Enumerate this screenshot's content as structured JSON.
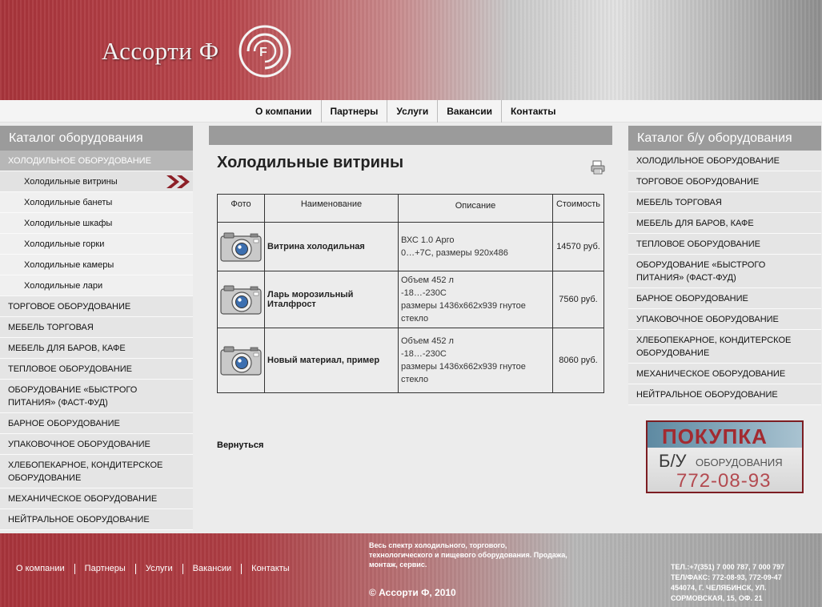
{
  "header": {
    "logo_text": "Ассорти Ф",
    "colors": {
      "brand_red": "#a8343b",
      "silver": "#c9c9c9"
    }
  },
  "top_nav": [
    "О компании",
    "Партнеры",
    "Услуги",
    "Вакансии",
    "Контакты"
  ],
  "left_sidebar": {
    "title": "Каталог оборудования",
    "active_category": "ХОЛОДИЛЬНОЕ ОБОРУДОВАНИЕ",
    "subitems": [
      "Холодильные витрины",
      "Холодильные банеты",
      "Холодильные шкафы",
      "Холодильные горки",
      "Холодильные камеры",
      "Холодильные лари"
    ],
    "current_subitem": "Холодильные витрины",
    "categories": [
      "ТОРГОВОЕ ОБОРУДОВАНИЕ",
      "МЕБЕЛЬ ТОРГОВАЯ",
      "МЕБЕЛЬ ДЛЯ БАРОВ, КАФЕ",
      "ТЕПЛОВОЕ ОБОРУДОВАНИЕ",
      "ОБОРУДОВАНИЕ «БЫСТРОГО ПИТАНИЯ» (ФАСТ-ФУД)",
      "БАРНОЕ ОБОРУДОВАНИЕ",
      "УПАКОВОЧНОЕ ОБОРУДОВАНИЕ",
      "ХЛЕБОПЕКАРНОЕ, КОНДИТЕРСКОЕ ОБОРУДОВАНИЕ",
      "МЕХАНИЧЕСКОЕ ОБОРУДОВАНИЕ",
      "НЕЙТРАЛЬНОЕ ОБОРУДОВАНИЕ"
    ]
  },
  "right_sidebar": {
    "title": "Каталог б/у оборудования",
    "categories": [
      "ХОЛОДИЛЬНОЕ ОБОРУДОВАНИЕ",
      "ТОРГОВОЕ ОБОРУДОВАНИЕ",
      "МЕБЕЛЬ ТОРГОВАЯ",
      "МЕБЕЛЬ ДЛЯ БАРОВ, КАФЕ",
      "ТЕПЛОВОЕ ОБОРУДОВАНИЕ",
      "ОБОРУДОВАНИЕ «БЫСТРОГО ПИТАНИЯ» (ФАСТ-ФУД)",
      "БАРНОЕ ОБОРУДОВАНИЕ",
      "УПАКОВОЧНОЕ ОБОРУДОВАНИЕ",
      "ХЛЕБОПЕКАРНОЕ, КОНДИТЕРСКОЕ ОБОРУДОВАНИЕ",
      "МЕХАНИЧЕСКОЕ ОБОРУДОВАНИЕ",
      "НЕЙТРАЛЬНОЕ ОБОРУДОВАНИЕ"
    ]
  },
  "main": {
    "title": "Холодильные витрины",
    "table": {
      "headers": [
        "Фото",
        "Наименование",
        "Описание",
        "Стоимость"
      ],
      "rows": [
        {
          "name": "Витрина холодильная",
          "desc": [
            "ВХС 1.0 Арго",
            "0…+7С, размеры 920х486"
          ],
          "price": "14570 руб."
        },
        {
          "name": "Ларь морозильный Италфрост",
          "desc": [
            "Объем 452 л",
            "-18…-230С",
            "размеры 1436х662х939 гнутое стекло"
          ],
          "price": "7560 руб."
        },
        {
          "name": "Новый материал, пример",
          "desc": [
            "Объем 452 л",
            "-18…-230С",
            "размеры 1436х662х939 гнутое стекло"
          ],
          "price": "8060 руб."
        }
      ]
    },
    "back_label": "Вернуться"
  },
  "banner": {
    "line1": "ПОКУПКА",
    "line2": "Б/У",
    "line3": "ОБОРУДОВАНИЯ",
    "phone": "772-08-93"
  },
  "footer": {
    "nav": [
      "О компании",
      "Партнеры",
      "Услуги",
      "Вакансии",
      "Контакты"
    ],
    "description": "Весь спектр холодильного, торгового, технологического и пищевого оборудования. Продажа, монтаж, сервис.",
    "copyright": "© Ассорти Ф, 2010",
    "contacts": [
      "ТЕЛ.:+7(351) 7 000 787, 7 000 797",
      "ТЕЛ/ФАКС: 772-08-93, 772-09-47",
      "454074, Г. ЧЕЛЯБИНСК, УЛ. СОРМОВСКАЯ, 15, ОФ. 21"
    ]
  }
}
